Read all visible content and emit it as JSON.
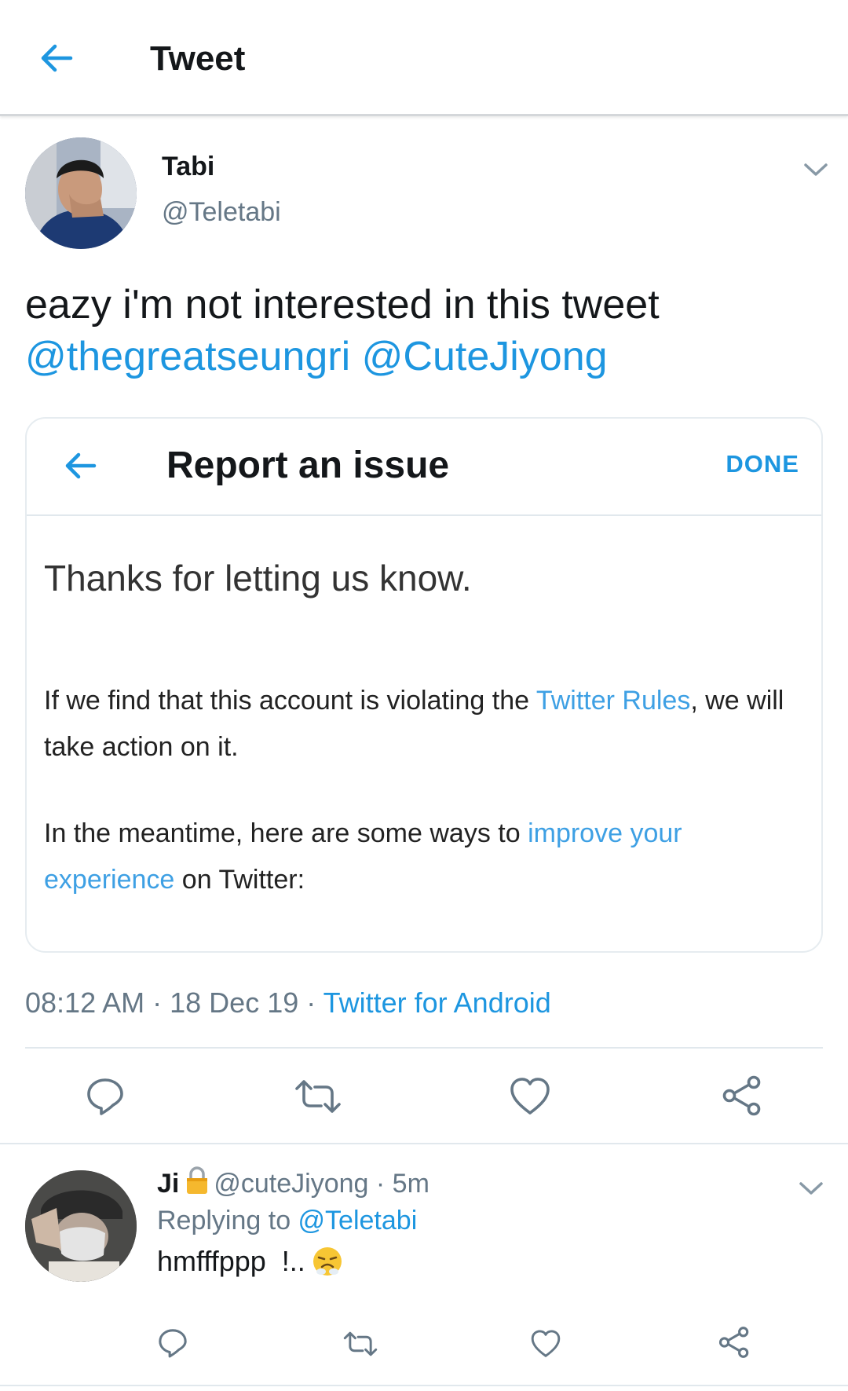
{
  "header": {
    "title": "Tweet",
    "back_icon": "back-arrow-icon"
  },
  "tweet": {
    "author_name": "Tabi",
    "author_handle": "@Teletabi",
    "text": "eazy i'm not interested in this tweet",
    "mentions": [
      "@thegreatseungri",
      "@CuteJiyong"
    ],
    "card": {
      "title": "Report an issue",
      "done_label": "DONE",
      "heading": "Thanks for letting us know.",
      "para1_before": "If we find that this account is violating the ",
      "para1_link": "Twitter Rules",
      "para1_after": ", we will take action on it.",
      "para2_before": "In the meantime, here are some ways to ",
      "para2_link": "improve your experience",
      "para2_after": " on Twitter:"
    },
    "time": "08:12 AM",
    "date": "18 Dec 19",
    "separator": "·",
    "source": "Twitter for Android"
  },
  "reply": {
    "name": "Ji",
    "handle": "@cuteJiyong",
    "time": "5m",
    "separator": "·",
    "replying_prefix": "Replying to ",
    "replying_to": "@Teletabi",
    "text": "hmfffppp  !.."
  },
  "colors": {
    "accent": "#1d96e0",
    "secondary_text": "#657786",
    "divider": "#e1e8ed"
  }
}
